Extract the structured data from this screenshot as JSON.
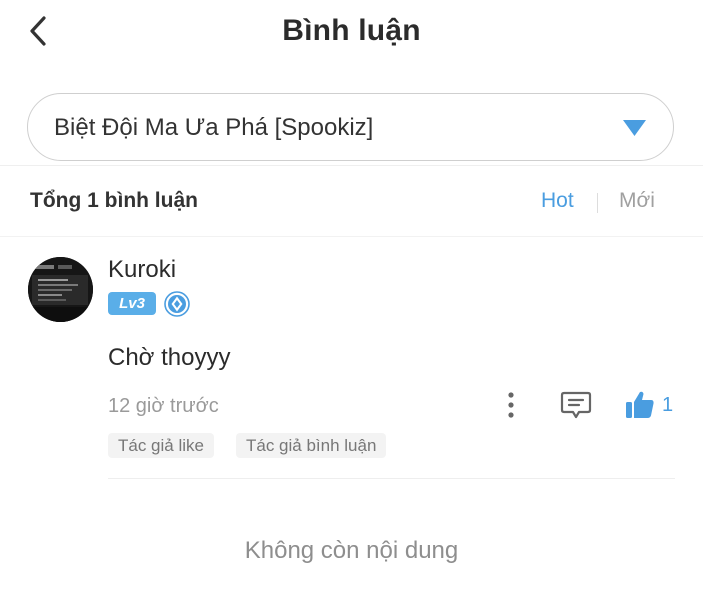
{
  "header": {
    "back_icon": "chevron-left-icon",
    "title": "Bình luận"
  },
  "selector": {
    "value": "Biệt Đội Ma Ưa Phá [Spookiz]",
    "arrow_icon": "triangle-down-icon",
    "arrow_color": "#4a9de0"
  },
  "comments_bar": {
    "total": "Tổng 1 bình luận",
    "sort_options": [
      {
        "label": "Hot",
        "active": true
      },
      {
        "label": "Mới",
        "active": false
      }
    ]
  },
  "comments": [
    {
      "username": "Kuroki",
      "level": "Lv3",
      "rank_icon": "diamond-rank-icon",
      "text": "Chờ thoyyy",
      "time": "12 giờ trước",
      "likes": "1",
      "tags": [
        "Tác giả like",
        "Tác giả bình luận"
      ]
    }
  ],
  "footer": {
    "end_text": "Không còn nội dung"
  },
  "colors": {
    "accent": "#4a9de0",
    "badge": "#5aaee8",
    "muted": "#9a9a9a"
  }
}
